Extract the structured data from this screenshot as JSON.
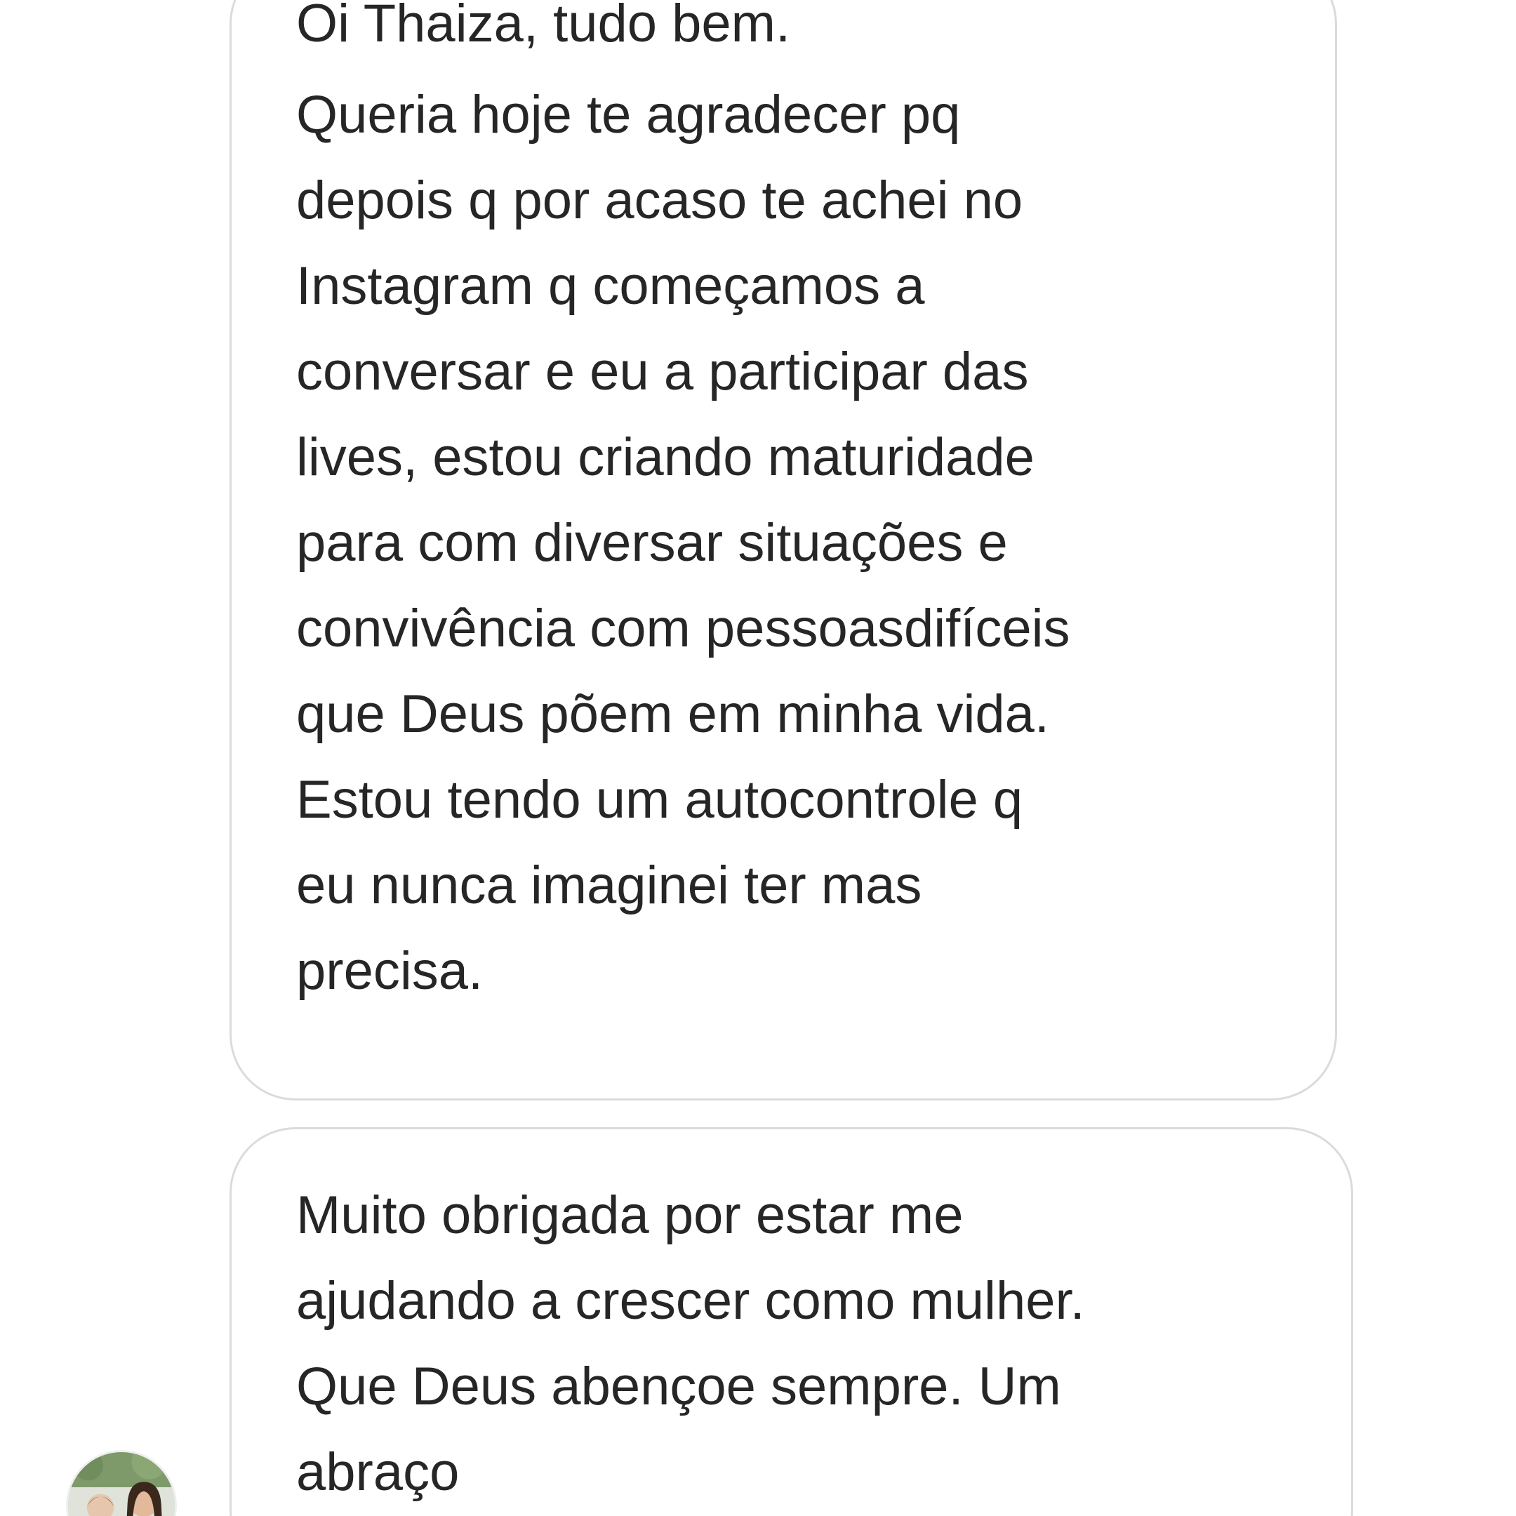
{
  "conversation": {
    "messages": [
      {
        "lines": [
          "Oi Thaiza, tudo bem.",
          "Queria hoje te agradecer pq",
          "depois q por acaso te achei no",
          "Instagram q começamos a",
          "conversar e eu a participar das",
          "lives, estou criando maturidade",
          "para com diversar situações e",
          "convivência com pessoasdifíceis",
          "que Deus põem em minha vida.",
          "Estou tendo um autocontrole q",
          "eu nunca imaginei ter mas",
          "precisa."
        ]
      },
      {
        "lines": [
          "Muito obrigada por estar me",
          "ajudando a crescer como mulher.",
          "Que Deus abençoe sempre. Um",
          "abraço"
        ]
      }
    ],
    "sender_avatar_icon": "profile-photo-avatar",
    "colors": {
      "text": "#262626",
      "bubble_border": "#dbdbdb",
      "background": "#ffffff"
    }
  }
}
